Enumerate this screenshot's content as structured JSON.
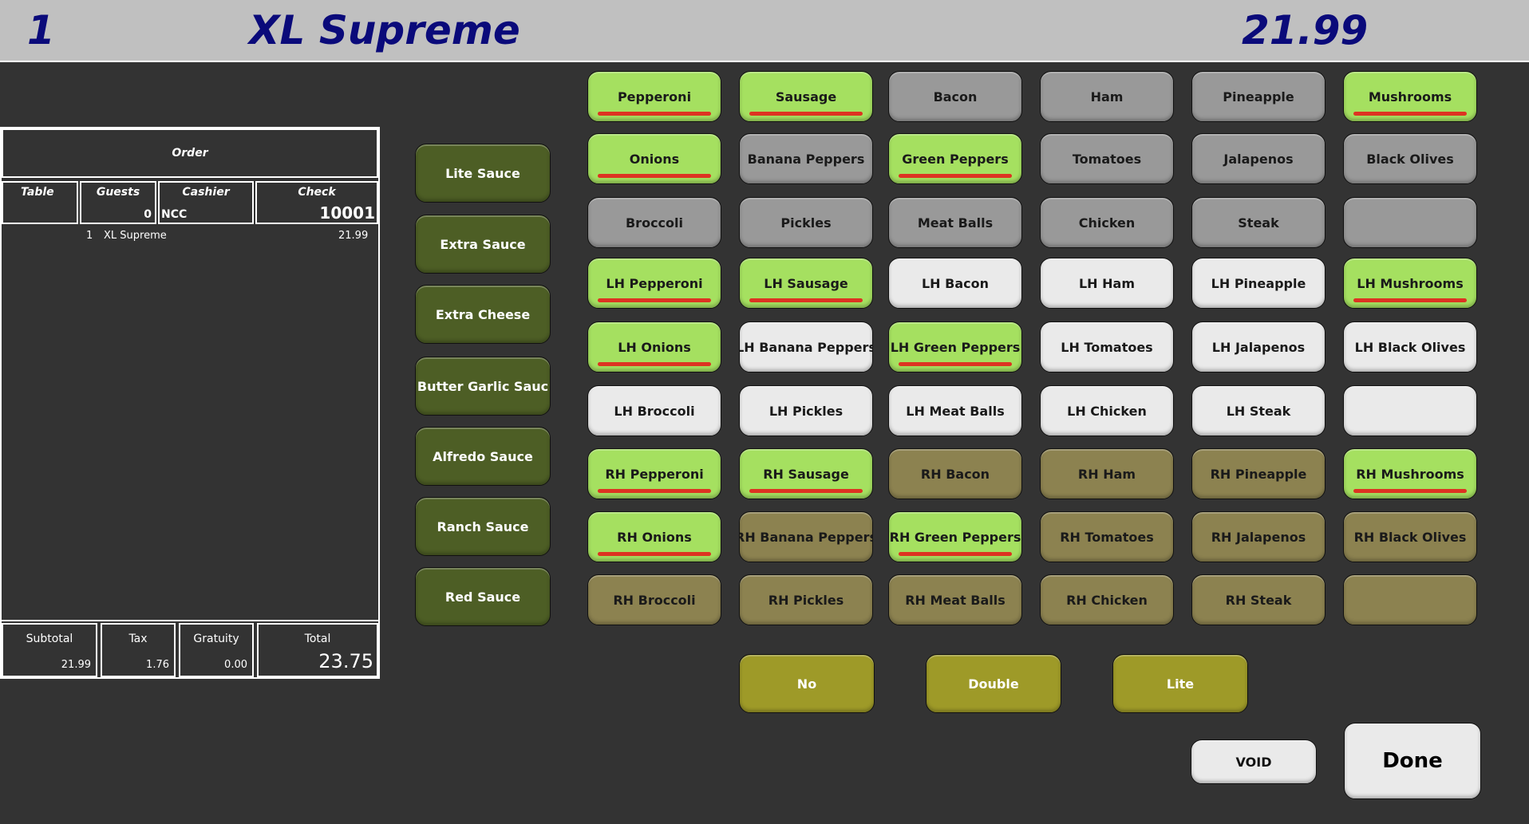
{
  "header": {
    "qty": "1",
    "item_name": "XL Supreme",
    "price": "21.99"
  },
  "order": {
    "title": "Order",
    "table_label": "Table",
    "table_value": "",
    "guests_label": "Guests",
    "guests_value": "0",
    "cashier_label": "Cashier",
    "cashier_value": "NCC",
    "check_label": "Check",
    "check_value": "10001",
    "lines": [
      {
        "qty": "1",
        "name": "XL Supreme",
        "price": "21.99"
      }
    ],
    "subtotal_label": "Subtotal",
    "subtotal_value": "21.99",
    "tax_label": "Tax",
    "tax_value": "1.76",
    "gratuity_label": "Gratuity",
    "gratuity_value": "0.00",
    "total_label": "Total",
    "total_value": "23.75"
  },
  "sauces": [
    "Lite Sauce",
    "Extra Sauce",
    "Extra Cheese",
    "Butter Garlic Sauc",
    "Alfredo Sauce",
    "Ranch Sauce",
    "Red Sauce"
  ],
  "toppings": [
    [
      "Pepperoni",
      "Sausage",
      "Bacon",
      "Ham",
      "Pineapple",
      "Mushrooms"
    ],
    [
      "Onions",
      "Banana Peppers",
      "Green Peppers",
      "Tomatoes",
      "Jalapenos",
      "Black Olives"
    ],
    [
      "Broccoli",
      "Pickles",
      "Meat Balls",
      "Chicken",
      "Steak",
      ""
    ],
    [
      "LH Pepperoni",
      "LH Sausage",
      "LH Bacon",
      "LH Ham",
      "LH Pineapple",
      "LH Mushrooms"
    ],
    [
      "LH Onions",
      "LH Banana Peppers",
      "LH Green Peppers",
      "LH Tomatoes",
      "LH Jalapenos",
      "LH Black Olives"
    ],
    [
      "LH Broccoli",
      "LH Pickles",
      "LH Meat Balls",
      "LH Chicken",
      "LH Steak",
      ""
    ],
    [
      "RH Pepperoni",
      "RH Sausage",
      "RH Bacon",
      "RH Ham",
      "RH Pineapple",
      "RH Mushrooms"
    ],
    [
      "RH Onions",
      "RH Banana Peppers",
      "RH Green Peppers",
      "RH Tomatoes",
      "RH Jalapenos",
      "RH Black Olives"
    ],
    [
      "RH Broccoli",
      "RH Pickles",
      "RH Meat Balls",
      "RH Chicken",
      "RH Steak",
      ""
    ]
  ],
  "selected": [
    [
      true,
      true,
      false,
      false,
      false,
      true
    ],
    [
      true,
      false,
      true,
      false,
      false,
      false
    ],
    [
      false,
      false,
      false,
      false,
      false,
      false
    ],
    [
      true,
      true,
      false,
      false,
      false,
      true
    ],
    [
      true,
      false,
      true,
      false,
      false,
      false
    ],
    [
      false,
      false,
      false,
      false,
      false,
      false
    ],
    [
      true,
      true,
      false,
      false,
      false,
      true
    ],
    [
      true,
      false,
      true,
      false,
      false,
      false
    ],
    [
      false,
      false,
      false,
      false,
      false,
      false
    ]
  ],
  "colors": {
    "selected": "#a5e060",
    "whole": "#999999",
    "left_half": "#eaeaea",
    "right_half": "#8c8250",
    "sauce": "#4d5e25",
    "modifier": "#9e9a28",
    "selected_bar": "#dd3322",
    "header_text": "#0a0a7a"
  },
  "modifiers": [
    "No",
    "Double",
    "Lite"
  ],
  "actions": {
    "void": "VOID",
    "done": "Done"
  }
}
